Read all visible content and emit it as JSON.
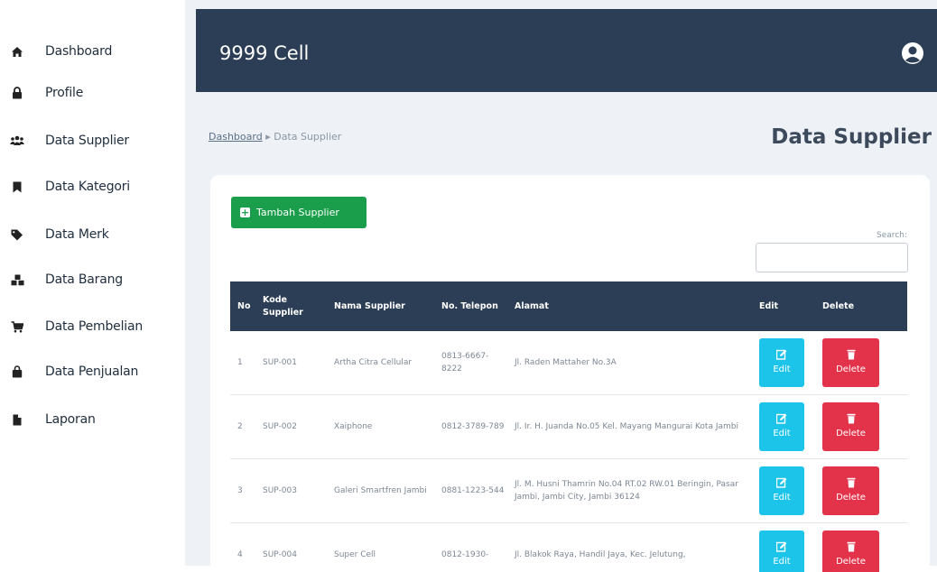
{
  "sidebar": {
    "items": [
      {
        "label": "Dashboard",
        "icon": "home-icon"
      },
      {
        "label": "Profile",
        "icon": "lock-icon"
      },
      {
        "label": "Data Supplier",
        "icon": "users-icon"
      },
      {
        "label": "Data Kategori",
        "icon": "bookmark-icon"
      },
      {
        "label": "Data Merk",
        "icon": "tag-icon"
      },
      {
        "label": "Data Barang",
        "icon": "cubes-icon"
      },
      {
        "label": "Data Pembelian",
        "icon": "cart-icon"
      },
      {
        "label": "Data Penjualan",
        "icon": "bag-icon"
      },
      {
        "label": "Laporan",
        "icon": "file-icon"
      }
    ]
  },
  "header": {
    "title": "9999 Cell",
    "user_icon": "user-circle-icon"
  },
  "breadcrumb": {
    "home": "Dashboard",
    "separator": "▸",
    "current": "Data Supplier"
  },
  "page": {
    "title": "Data Supplier"
  },
  "toolbar": {
    "add_label": "Tambah Supplier",
    "search_label": "Search:",
    "search_value": ""
  },
  "table": {
    "headers": {
      "no": "No",
      "kode": "Kode Supplier",
      "nama": "Nama Supplier",
      "telepon": "No. Telepon",
      "alamat": "Alamat",
      "edit": "Edit",
      "delete": "Delete"
    },
    "rows": [
      {
        "no": "1",
        "kode": "SUP-001",
        "nama": "Artha Citra Cellular",
        "telepon": "0813-6667-8222",
        "alamat": "Jl. Raden Mattaher No.3A"
      },
      {
        "no": "2",
        "kode": "SUP-002",
        "nama": "Xaiphone",
        "telepon": "0812-3789-789",
        "alamat": "Jl. Ir. H. Juanda No.05 Kel. Mayang Mangurai Kota Jambi"
      },
      {
        "no": "3",
        "kode": "SUP-003",
        "nama": "Galeri Smartfren Jambi",
        "telepon": "0881-1223-544",
        "alamat": "Jl. M. Husni Thamrin No.04 RT.02 RW.01 Beringin, Pasar Jambi, Jambi City, Jambi 36124"
      },
      {
        "no": "4",
        "kode": "SUP-004",
        "nama": "Super Cell",
        "telepon": "0812-1930-",
        "alamat": "Jl. Blakok Raya, Handil Jaya, Kec. Jelutung,"
      }
    ],
    "edit_label": "Edit",
    "delete_label": "Delete"
  },
  "colors": {
    "topbar": "#2c3e55",
    "add_button": "#1a9e4b",
    "edit_button": "#1cc4ea",
    "delete_button": "#e3334a"
  }
}
